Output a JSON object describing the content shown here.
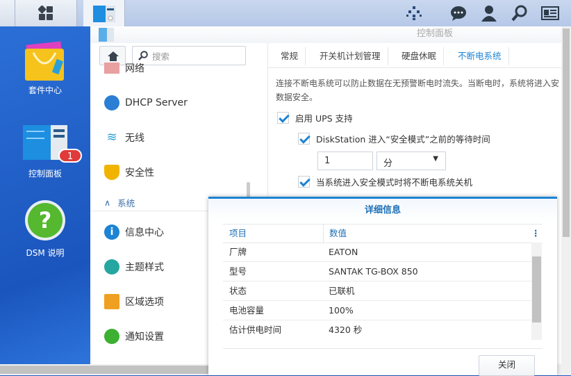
{
  "taskbar": {
    "icons": [
      "main-menu-icon",
      "control-panel-icon",
      "widgets-icon",
      "chat-icon",
      "user-icon",
      "search-icon",
      "options-icon"
    ]
  },
  "desktop": {
    "items": [
      {
        "label": "套件中心",
        "icon": "package-center-icon"
      },
      {
        "label": "控制面板",
        "icon": "control-panel-icon",
        "badge": "1"
      },
      {
        "label": "DSM 说明",
        "icon": "help-icon"
      }
    ]
  },
  "window": {
    "title": "控制面板",
    "search_placeholder": "搜索",
    "sidebar": {
      "partial_item": "网络",
      "items": [
        {
          "label": "DHCP Server",
          "color": "#2a7fd4"
        },
        {
          "label": "无线",
          "color": "#2a9fd4"
        },
        {
          "label": "安全性",
          "color": "#f0b400"
        }
      ],
      "section": "系统",
      "section_items": [
        {
          "label": "信息中心",
          "color": "#1d83d4"
        },
        {
          "label": "主题样式",
          "color": "#26a6a0"
        },
        {
          "label": "区域选项",
          "color": "#f0a020"
        },
        {
          "label": "通知设置",
          "color": "#3cb030"
        }
      ]
    },
    "tabs": [
      "常规",
      "开关机计划管理",
      "硬盘休眠",
      "不断电系统"
    ],
    "active_tab": 3,
    "description_line1": "连接不断电系统可以防止数据在无预警断电时流失。当断电时，系统将进入安",
    "description_line2": "数据安全。",
    "enable_ups": "启用 UPS 支持",
    "wait_time_label": "DiskStation 进入“安全模式”之前的等待时间",
    "wait_value": "1",
    "wait_unit": "分",
    "shutdown_ups": "当系统进入安全模式时将不断电系统关机"
  },
  "dialog": {
    "title": "详细信息",
    "columns": [
      "项目",
      "数值"
    ],
    "rows": [
      [
        "厂牌",
        "EATON"
      ],
      [
        "型号",
        "SANTAK TG-BOX 850"
      ],
      [
        "状态",
        "已联机"
      ],
      [
        "电池容量",
        "100%"
      ],
      [
        "估计供电时间",
        "4320 秒"
      ]
    ],
    "close": "关闭"
  },
  "colors": {
    "accent": "#1d83d4"
  }
}
